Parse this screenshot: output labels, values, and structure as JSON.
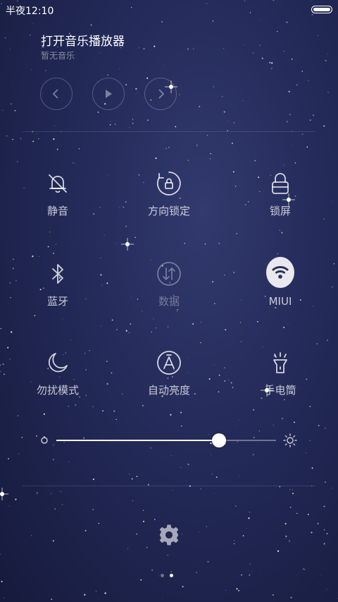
{
  "status_bar": {
    "time": "半夜12:10",
    "battery_icon": "battery-full-icon"
  },
  "music": {
    "title": "打开音乐播放器",
    "subtitle": "暂无音乐",
    "controls": [
      "previous-icon",
      "play-icon",
      "next-icon"
    ]
  },
  "toggles": [
    {
      "label": "静音",
      "icon": "bell-off-icon"
    },
    {
      "label": "方向锁定",
      "icon": "rotation-lock-icon"
    },
    {
      "label": "锁屏",
      "icon": "lock-icon"
    },
    {
      "label": "蓝牙",
      "icon": "bluetooth-icon"
    },
    {
      "label": "数据",
      "icon": "mobile-data-icon"
    },
    {
      "label": "MIUI",
      "icon": "wifi-icon"
    },
    {
      "label": "勿扰模式",
      "icon": "moon-icon"
    },
    {
      "label": "自动亮度",
      "icon": "auto-brightness-icon"
    },
    {
      "label": "手电筒",
      "icon": "flashlight-icon"
    }
  ],
  "brightness": {
    "level": 0.74,
    "min_icon": "brightness-low-icon",
    "max_icon": "brightness-high-icon"
  },
  "settings_icon": "gear-icon",
  "pager": {
    "count": 2,
    "active": 1
  },
  "colors": {
    "background": "#232a58",
    "accent": "#ffffff"
  }
}
